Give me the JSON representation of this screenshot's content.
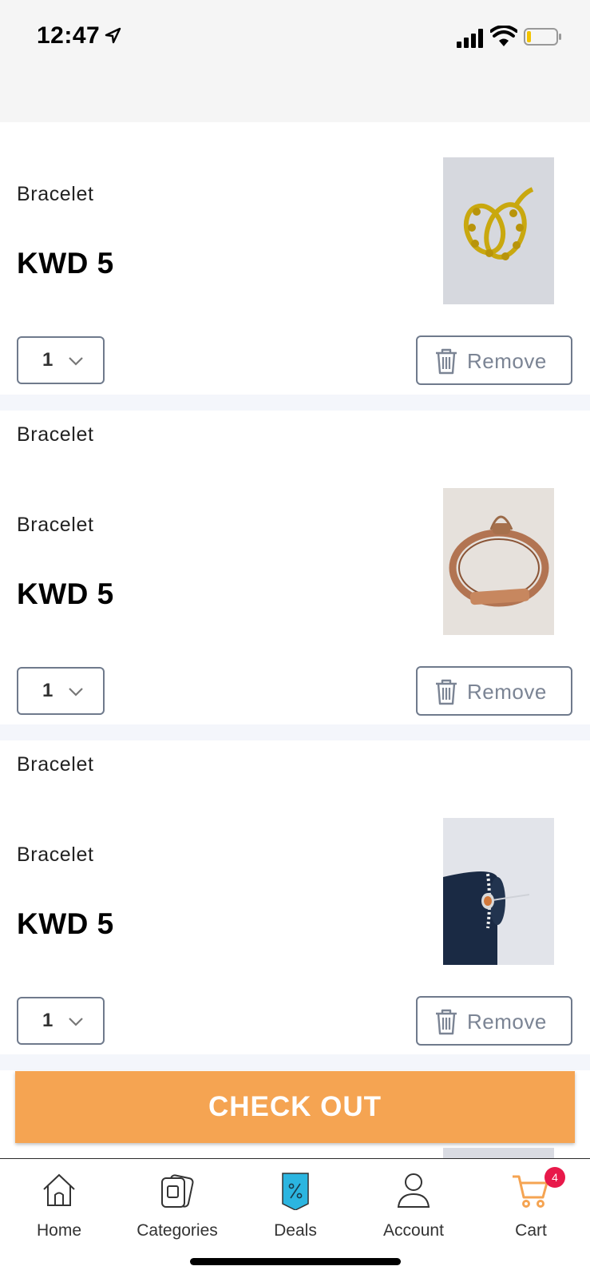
{
  "status_bar": {
    "time": "12:47"
  },
  "cart": {
    "items": [
      {
        "heading": "",
        "name": "Bracelet",
        "price": "KWD 5",
        "quantity": "1",
        "remove_label": "Remove",
        "image": "gold-chain-bracelet"
      },
      {
        "heading": "Bracelet",
        "name": "Bracelet",
        "price": "KWD 5",
        "quantity": "1",
        "remove_label": "Remove",
        "image": "rose-gold-bangle"
      },
      {
        "heading": "Bracelet",
        "name": "Bracelet",
        "price": "KWD 5",
        "quantity": "1",
        "remove_label": "Remove",
        "image": "silver-pendant-bracelet"
      }
    ]
  },
  "checkout": {
    "label": "CHECK OUT",
    "color": "#f5a452"
  },
  "tab_bar": {
    "tabs": [
      {
        "label": "Home",
        "icon": "home-icon"
      },
      {
        "label": "Categories",
        "icon": "categories-icon"
      },
      {
        "label": "Deals",
        "icon": "deals-icon"
      },
      {
        "label": "Account",
        "icon": "account-icon"
      },
      {
        "label": "Cart",
        "icon": "cart-icon",
        "badge": "4",
        "accent": "#f5a452"
      }
    ]
  }
}
